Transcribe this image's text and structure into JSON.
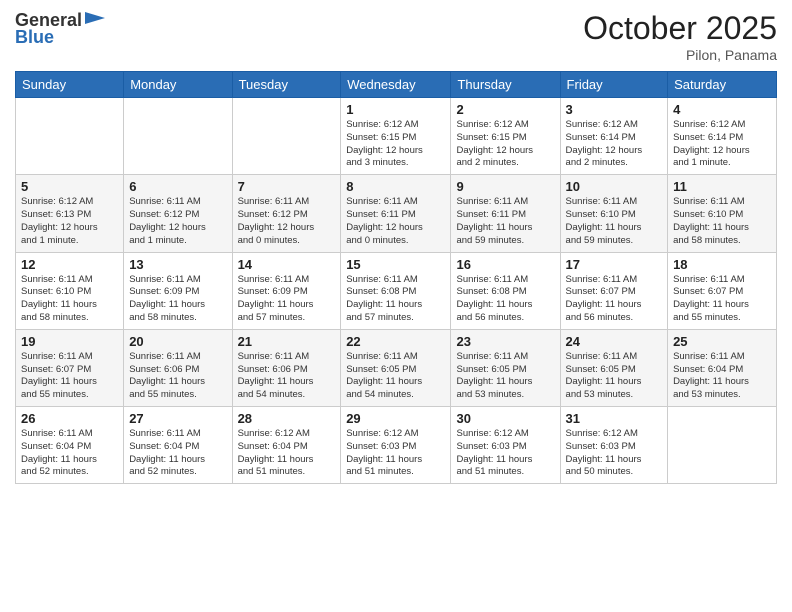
{
  "header": {
    "logo_general": "General",
    "logo_blue": "Blue",
    "month": "October 2025",
    "location": "Pilon, Panama"
  },
  "days_of_week": [
    "Sunday",
    "Monday",
    "Tuesday",
    "Wednesday",
    "Thursday",
    "Friday",
    "Saturday"
  ],
  "weeks": [
    [
      {
        "num": "",
        "info": ""
      },
      {
        "num": "",
        "info": ""
      },
      {
        "num": "",
        "info": ""
      },
      {
        "num": "1",
        "info": "Sunrise: 6:12 AM\nSunset: 6:15 PM\nDaylight: 12 hours\nand 3 minutes."
      },
      {
        "num": "2",
        "info": "Sunrise: 6:12 AM\nSunset: 6:15 PM\nDaylight: 12 hours\nand 2 minutes."
      },
      {
        "num": "3",
        "info": "Sunrise: 6:12 AM\nSunset: 6:14 PM\nDaylight: 12 hours\nand 2 minutes."
      },
      {
        "num": "4",
        "info": "Sunrise: 6:12 AM\nSunset: 6:14 PM\nDaylight: 12 hours\nand 1 minute."
      }
    ],
    [
      {
        "num": "5",
        "info": "Sunrise: 6:12 AM\nSunset: 6:13 PM\nDaylight: 12 hours\nand 1 minute."
      },
      {
        "num": "6",
        "info": "Sunrise: 6:11 AM\nSunset: 6:12 PM\nDaylight: 12 hours\nand 1 minute."
      },
      {
        "num": "7",
        "info": "Sunrise: 6:11 AM\nSunset: 6:12 PM\nDaylight: 12 hours\nand 0 minutes."
      },
      {
        "num": "8",
        "info": "Sunrise: 6:11 AM\nSunset: 6:11 PM\nDaylight: 12 hours\nand 0 minutes."
      },
      {
        "num": "9",
        "info": "Sunrise: 6:11 AM\nSunset: 6:11 PM\nDaylight: 11 hours\nand 59 minutes."
      },
      {
        "num": "10",
        "info": "Sunrise: 6:11 AM\nSunset: 6:10 PM\nDaylight: 11 hours\nand 59 minutes."
      },
      {
        "num": "11",
        "info": "Sunrise: 6:11 AM\nSunset: 6:10 PM\nDaylight: 11 hours\nand 58 minutes."
      }
    ],
    [
      {
        "num": "12",
        "info": "Sunrise: 6:11 AM\nSunset: 6:10 PM\nDaylight: 11 hours\nand 58 minutes."
      },
      {
        "num": "13",
        "info": "Sunrise: 6:11 AM\nSunset: 6:09 PM\nDaylight: 11 hours\nand 58 minutes."
      },
      {
        "num": "14",
        "info": "Sunrise: 6:11 AM\nSunset: 6:09 PM\nDaylight: 11 hours\nand 57 minutes."
      },
      {
        "num": "15",
        "info": "Sunrise: 6:11 AM\nSunset: 6:08 PM\nDaylight: 11 hours\nand 57 minutes."
      },
      {
        "num": "16",
        "info": "Sunrise: 6:11 AM\nSunset: 6:08 PM\nDaylight: 11 hours\nand 56 minutes."
      },
      {
        "num": "17",
        "info": "Sunrise: 6:11 AM\nSunset: 6:07 PM\nDaylight: 11 hours\nand 56 minutes."
      },
      {
        "num": "18",
        "info": "Sunrise: 6:11 AM\nSunset: 6:07 PM\nDaylight: 11 hours\nand 55 minutes."
      }
    ],
    [
      {
        "num": "19",
        "info": "Sunrise: 6:11 AM\nSunset: 6:07 PM\nDaylight: 11 hours\nand 55 minutes."
      },
      {
        "num": "20",
        "info": "Sunrise: 6:11 AM\nSunset: 6:06 PM\nDaylight: 11 hours\nand 55 minutes."
      },
      {
        "num": "21",
        "info": "Sunrise: 6:11 AM\nSunset: 6:06 PM\nDaylight: 11 hours\nand 54 minutes."
      },
      {
        "num": "22",
        "info": "Sunrise: 6:11 AM\nSunset: 6:05 PM\nDaylight: 11 hours\nand 54 minutes."
      },
      {
        "num": "23",
        "info": "Sunrise: 6:11 AM\nSunset: 6:05 PM\nDaylight: 11 hours\nand 53 minutes."
      },
      {
        "num": "24",
        "info": "Sunrise: 6:11 AM\nSunset: 6:05 PM\nDaylight: 11 hours\nand 53 minutes."
      },
      {
        "num": "25",
        "info": "Sunrise: 6:11 AM\nSunset: 6:04 PM\nDaylight: 11 hours\nand 53 minutes."
      }
    ],
    [
      {
        "num": "26",
        "info": "Sunrise: 6:11 AM\nSunset: 6:04 PM\nDaylight: 11 hours\nand 52 minutes."
      },
      {
        "num": "27",
        "info": "Sunrise: 6:11 AM\nSunset: 6:04 PM\nDaylight: 11 hours\nand 52 minutes."
      },
      {
        "num": "28",
        "info": "Sunrise: 6:12 AM\nSunset: 6:04 PM\nDaylight: 11 hours\nand 51 minutes."
      },
      {
        "num": "29",
        "info": "Sunrise: 6:12 AM\nSunset: 6:03 PM\nDaylight: 11 hours\nand 51 minutes."
      },
      {
        "num": "30",
        "info": "Sunrise: 6:12 AM\nSunset: 6:03 PM\nDaylight: 11 hours\nand 51 minutes."
      },
      {
        "num": "31",
        "info": "Sunrise: 6:12 AM\nSunset: 6:03 PM\nDaylight: 11 hours\nand 50 minutes."
      },
      {
        "num": "",
        "info": ""
      }
    ]
  ]
}
